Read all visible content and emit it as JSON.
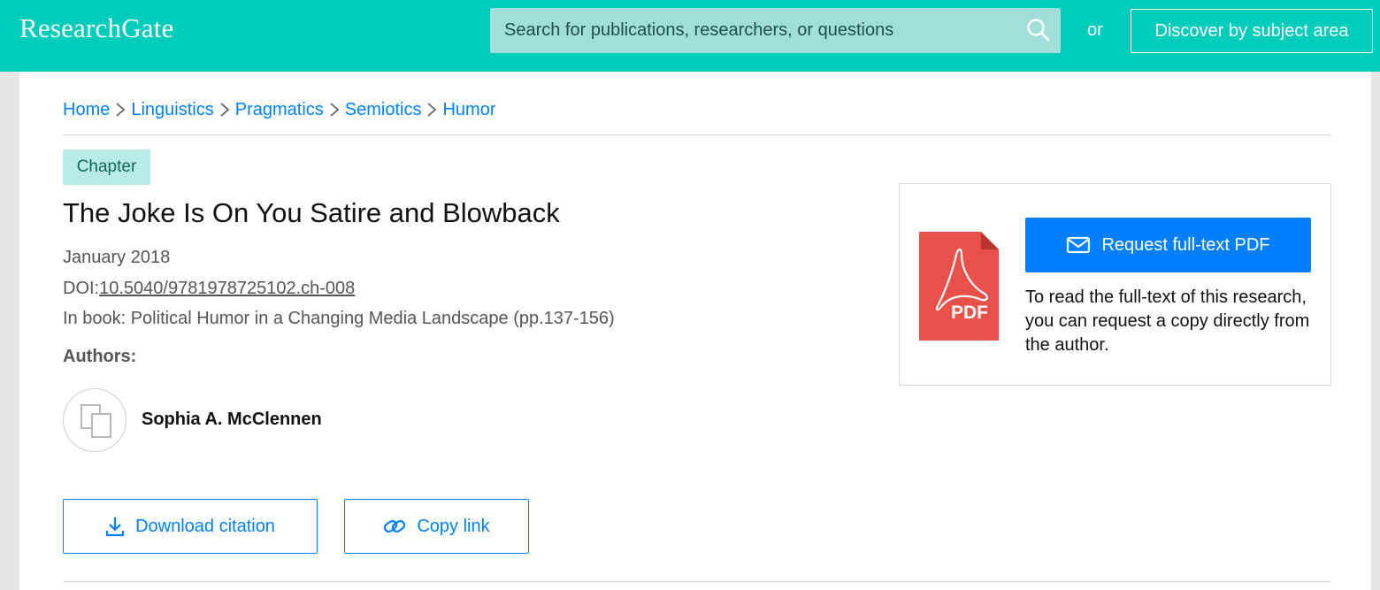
{
  "header": {
    "logo": "ResearchGate",
    "search_placeholder": "Search for publications, researchers, or questions",
    "or_label": "or",
    "discover_label": "Discover by subject area",
    "brand_color": "#00ccbb"
  },
  "breadcrumb": [
    "Home",
    "Linguistics",
    "Pragmatics",
    "Semiotics",
    "Humor"
  ],
  "publication": {
    "type_badge": "Chapter",
    "title": "The Joke Is On You Satire and Blowback",
    "date": "January 2018",
    "doi_label": "DOI:",
    "doi": "10.5040/9781978725102.ch-008",
    "book": "In book: Political Humor in a Changing Media Landscape (pp.137-156)",
    "authors_label": "Authors:",
    "authors": [
      {
        "name": "Sophia A. McClennen"
      }
    ]
  },
  "actions": {
    "download_citation": "Download citation",
    "copy_link": "Copy link"
  },
  "fulltext": {
    "pdf_label": "PDF",
    "request_button": "Request full-text PDF",
    "description": "To read the full-text of this research, you can request a copy directly from the author.",
    "accent_color": "#0080ff"
  }
}
